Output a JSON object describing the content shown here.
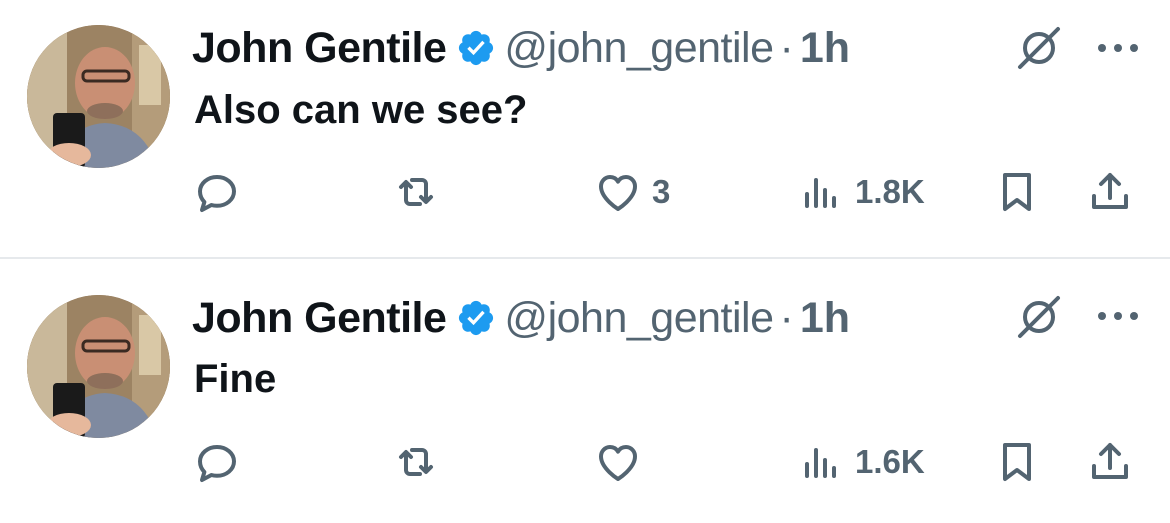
{
  "tweets": [
    {
      "author_name": "John Gentile",
      "handle": "@john_gentile",
      "separator": "·",
      "time": "1h",
      "text": "Also can we see?",
      "likes": "3",
      "views": "1.8K"
    },
    {
      "author_name": "John Gentile",
      "handle": "@john_gentile",
      "separator": "·",
      "time": "1h",
      "text": "Fine",
      "likes": "",
      "views": "1.6K"
    }
  ],
  "icons": {
    "verified": "verified-badge-icon",
    "grok": "grok-icon",
    "more": "more-icon",
    "reply": "reply-icon",
    "retweet": "retweet-icon",
    "like": "heart-icon",
    "views": "views-icon",
    "bookmark": "bookmark-icon",
    "share": "share-icon"
  },
  "colors": {
    "verified": "#1d9bf0",
    "secondary_text": "#536471",
    "primary_text": "#0f1419",
    "divider": "#e6e9ec"
  }
}
